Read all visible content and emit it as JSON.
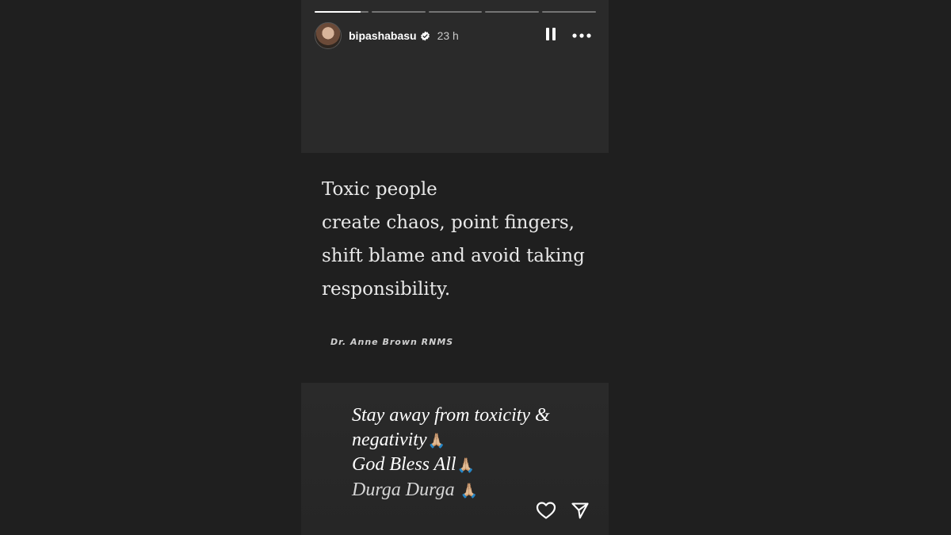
{
  "story": {
    "username": "bipashabasu",
    "time_ago": "23 h",
    "progress_segments": [
      1,
      0,
      0,
      0,
      0
    ],
    "current_segment_progress": 0.85,
    "quote_lines": [
      "Toxic people",
      "create chaos, point fingers,",
      "shift blame and avoid taking",
      "responsibility."
    ],
    "quote_author": "Dr. Anne Brown RNMS",
    "caption_lines": [
      "Stay away from toxicity &",
      "negativity",
      "God Bless All",
      "Durga Durga "
    ],
    "caption_emoji": "🙏🏼"
  },
  "icons": {
    "verified": "verified-badge-icon",
    "pause": "pause-icon",
    "more": "more-options-icon",
    "like": "heart-icon",
    "share": "send-icon"
  }
}
